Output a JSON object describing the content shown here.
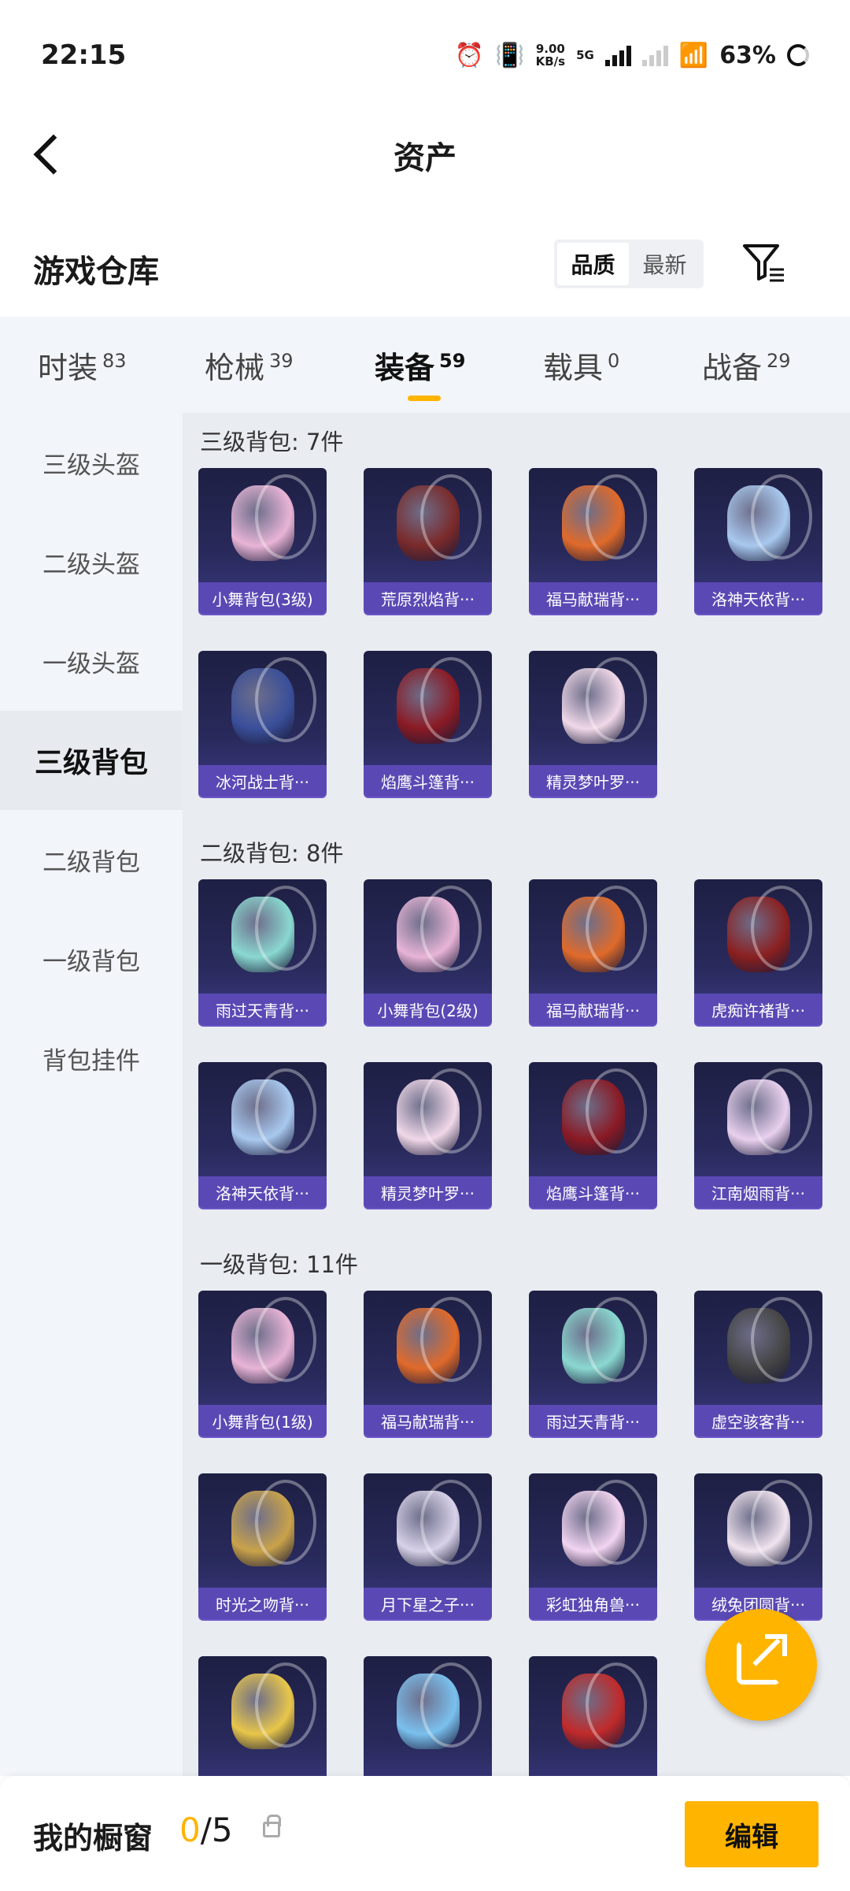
{
  "status_bar": {
    "time": "22:15",
    "net_speed_value": "9.00",
    "net_speed_unit": "KB/s",
    "network": "5G",
    "battery": "63%"
  },
  "header": {
    "title": "资产"
  },
  "warehouse": {
    "title": "游戏仓库",
    "sort_options": [
      "品质",
      "最新"
    ],
    "active_sort": "品质"
  },
  "tabs": [
    {
      "label": "时装",
      "count": "83"
    },
    {
      "label": "枪械",
      "count": "39"
    },
    {
      "label": "装备",
      "count": "59",
      "active": true
    },
    {
      "label": "载具",
      "count": "0"
    },
    {
      "label": "战备",
      "count": "29"
    }
  ],
  "sidebar": [
    {
      "label": "三级头盔"
    },
    {
      "label": "二级头盔"
    },
    {
      "label": "一级头盔"
    },
    {
      "label": "三级背包",
      "active": true
    },
    {
      "label": "二级背包"
    },
    {
      "label": "一级背包"
    },
    {
      "label": "背包挂件"
    }
  ],
  "groups": [
    {
      "title": "三级背包: 7件",
      "items": [
        {
          "name": "小舞背包(3级)",
          "color": "#e8b4d6"
        },
        {
          "name": "荒原烈焰背···",
          "color": "#7a2a2a"
        },
        {
          "name": "福马献瑞背···",
          "color": "#e06a2a"
        },
        {
          "name": "洛神天依背···",
          "color": "#a8c8ee"
        },
        {
          "name": "冰河战士背···",
          "color": "#3a4f9a"
        },
        {
          "name": "焰鹰斗篷背···",
          "color": "#8a1a24"
        },
        {
          "name": "精灵梦叶罗···",
          "color": "#f0d8e8"
        }
      ]
    },
    {
      "title": "二级背包: 8件",
      "items": [
        {
          "name": "雨过天青背···",
          "color": "#8ad8d0"
        },
        {
          "name": "小舞背包(2级)",
          "color": "#e8b4d6"
        },
        {
          "name": "福马献瑞背···",
          "color": "#e06a2a"
        },
        {
          "name": "虎痴许褚背···",
          "color": "#8a2020"
        },
        {
          "name": "洛神天依背···",
          "color": "#a8c8ee"
        },
        {
          "name": "精灵梦叶罗···",
          "color": "#f0d8e8"
        },
        {
          "name": "焰鹰斗篷背···",
          "color": "#8a1a24"
        },
        {
          "name": "江南烟雨背···",
          "color": "#e8d0ee"
        }
      ]
    },
    {
      "title": "一级背包: 11件",
      "items": [
        {
          "name": "小舞背包(1级)",
          "color": "#e8b4d6"
        },
        {
          "name": "福马献瑞背···",
          "color": "#e06a2a"
        },
        {
          "name": "雨过天青背···",
          "color": "#8ad8d0"
        },
        {
          "name": "虚空骇客背···",
          "color": "#444444"
        },
        {
          "name": "时光之吻背···",
          "color": "#c9a24a"
        },
        {
          "name": "月下星之子···",
          "color": "#d8d2e8"
        },
        {
          "name": "彩虹独角兽···",
          "color": "#f2d4f0"
        },
        {
          "name": "绒兔团圆背···",
          "color": "#f0e4ee"
        },
        {
          "name": "",
          "color": "#e8c64a"
        },
        {
          "name": "",
          "color": "#7ac0ee"
        },
        {
          "name": "",
          "color": "#c02a2a"
        }
      ]
    }
  ],
  "bottom_bar": {
    "label": "我的橱窗",
    "used": "0",
    "total": "/5",
    "edit_label": "编辑"
  }
}
